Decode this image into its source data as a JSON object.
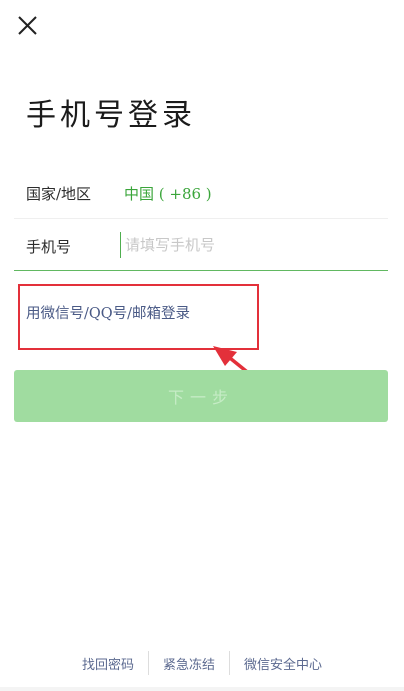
{
  "title": "手机号登录",
  "region": {
    "label": "国家/地区",
    "value": "中国 ( +86 )"
  },
  "phone": {
    "label": "手机号",
    "value": "",
    "placeholder": "请填写手机号"
  },
  "alt_login_label": "用微信号/QQ号/邮箱登录",
  "next_button_label": "下一步",
  "footer": {
    "links": [
      "找回密码",
      "紧急冻结",
      "微信安全中心"
    ]
  },
  "colors": {
    "accent": "#3aa53a",
    "button": "#a0dca0",
    "link": "#4a5a86",
    "highlight": "#e3303a"
  },
  "icons": {
    "close": "close-icon"
  }
}
